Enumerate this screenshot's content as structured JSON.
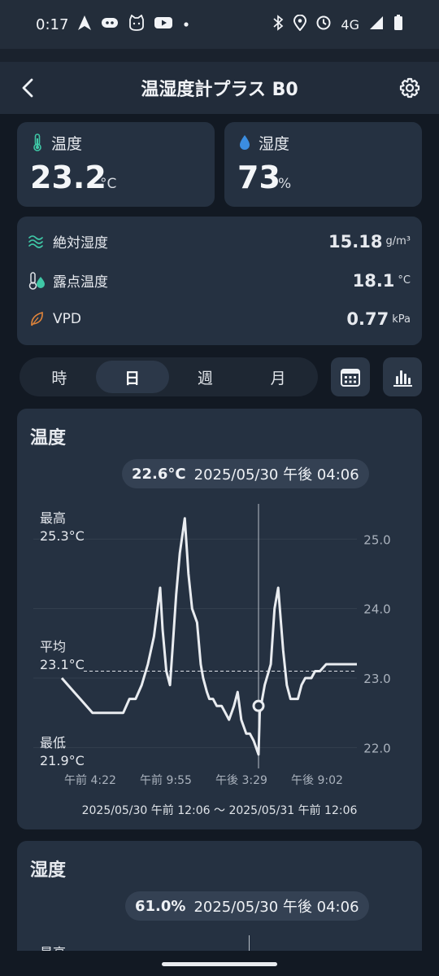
{
  "status": {
    "time": "0:17",
    "network": "4G"
  },
  "header": {
    "title": "温湿度計プラス B0"
  },
  "temperature": {
    "label": "温度",
    "value": "23.2",
    "unit": "°C"
  },
  "humidity": {
    "label": "湿度",
    "value": "73",
    "unit": "%"
  },
  "metrics": [
    {
      "label": "絶対湿度",
      "value": "15.18",
      "unit": "g/m³"
    },
    {
      "label": "露点温度",
      "value": "18.1",
      "unit": "°C"
    },
    {
      "label": "VPD",
      "value": "0.77",
      "unit": "kPa"
    }
  ],
  "period_tabs": [
    "時",
    "日",
    "週",
    "月"
  ],
  "selected_tab": "日",
  "temp_chart": {
    "title": "温度",
    "tooltip_value": "22.6°C",
    "tooltip_time": "2025/05/30 午後 04:06",
    "max_label": "最高",
    "max_value": "25.3°C",
    "avg_label": "平均",
    "avg_value": "23.1°C",
    "min_label": "最低",
    "min_value": "21.9°C",
    "range": "2025/05/30 午前 12:06 〜 2025/05/31 午前 12:06"
  },
  "humidity_chart": {
    "title": "湿度",
    "tooltip_value": "61.0%",
    "tooltip_time": "2025/05/30 午後 04:06",
    "max_label": "最高"
  },
  "chart_data": {
    "type": "line",
    "title": "温度",
    "x_ticks": [
      "午前 4:22",
      "午前 9:55",
      "午後 3:29",
      "午後 9:02"
    ],
    "x": [
      0.0,
      0.5,
      1.0,
      1.5,
      2.0,
      2.5,
      3.0,
      3.5,
      4.0,
      4.5,
      5.0,
      5.5,
      6.0,
      6.5,
      7.0,
      7.5,
      8.0,
      8.2,
      8.5,
      8.8,
      9.0,
      9.3,
      9.6,
      10.0,
      10.3,
      10.6,
      11.0,
      11.3,
      11.5,
      11.8,
      12.0,
      12.3,
      12.6,
      13.0,
      13.3,
      13.6,
      14.0,
      14.3,
      14.6,
      15.0,
      15.3,
      15.6,
      16.0,
      16.1,
      16.5,
      17.0,
      17.3,
      17.6,
      18.0,
      18.3,
      18.6,
      19.0,
      19.2,
      19.5,
      19.8,
      20.0,
      20.3,
      20.6,
      21.0,
      21.5,
      22.0,
      22.5,
      23.0,
      23.5,
      24.0
    ],
    "y": [
      23.0,
      22.9,
      22.8,
      22.7,
      22.6,
      22.5,
      22.5,
      22.5,
      22.5,
      22.5,
      22.5,
      22.7,
      22.7,
      22.9,
      23.2,
      23.6,
      24.3,
      23.7,
      23.1,
      22.9,
      23.4,
      24.2,
      24.8,
      25.3,
      24.5,
      24.0,
      23.8,
      23.2,
      23.0,
      22.8,
      22.7,
      22.7,
      22.6,
      22.6,
      22.5,
      22.4,
      22.6,
      22.8,
      22.4,
      22.2,
      22.2,
      22.1,
      21.9,
      22.5,
      22.9,
      23.2,
      24.0,
      24.3,
      23.4,
      22.9,
      22.7,
      22.7,
      22.7,
      22.9,
      23.0,
      23.0,
      23.0,
      23.1,
      23.1,
      23.2,
      23.2,
      23.2,
      23.2,
      23.2,
      23.2
    ],
    "yticks": [
      22.0,
      23.0,
      24.0,
      25.0
    ],
    "ylim": [
      21.7,
      25.8
    ],
    "xlim": [
      0,
      24
    ],
    "average": 23.1,
    "cursor_x": 16.0,
    "cursor_y": 22.6
  }
}
